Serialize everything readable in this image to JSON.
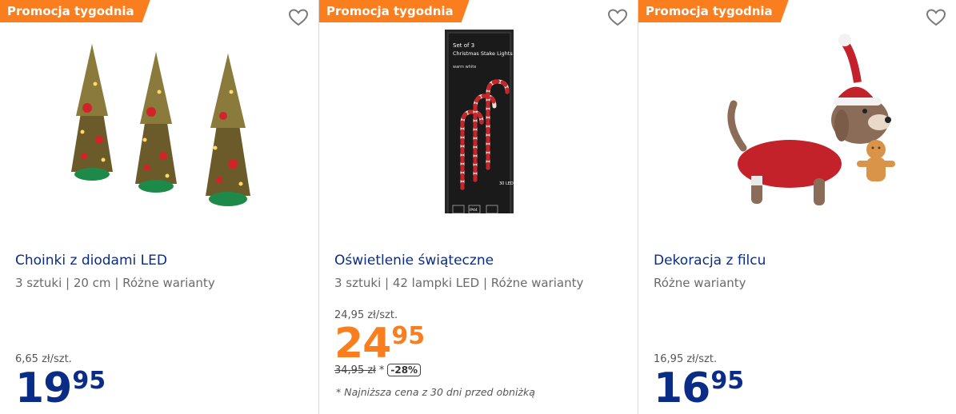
{
  "products": [
    {
      "badge": "Promocja tygodnia",
      "name": "Choinki z diodami LED",
      "desc": "3 sztuki | 20 cm | Różne warianty",
      "unit_price": "6,65 zł/szt.",
      "price_int": "19",
      "price_dec": "95"
    },
    {
      "badge": "Promocja tygodnia",
      "name": "Oświetlenie świąteczne",
      "desc": "3 sztuki | 42 lampki LED | Różne warianty",
      "unit_price": "24,95 zł/szt.",
      "price_int": "24",
      "price_dec": "95",
      "old_price": "34,95 zł",
      "old_marker": "*",
      "discount": "-28%",
      "footnote": "* Najniższa cena z 30 dni przed obniżką",
      "box_title": "Set of 3\nChristmas Stake Lights",
      "box_subtitle": "warm white",
      "box_count": "30 LED",
      "box_ip": "IP44"
    },
    {
      "badge": "Promocja tygodnia",
      "name": "Dekoracja z filcu",
      "desc": "Różne warianty",
      "unit_price": "16,95 zł/szt.",
      "price_int": "16",
      "price_dec": "95"
    }
  ],
  "colors": {
    "accent": "#fa7d1e",
    "brand": "#0b2c86"
  }
}
